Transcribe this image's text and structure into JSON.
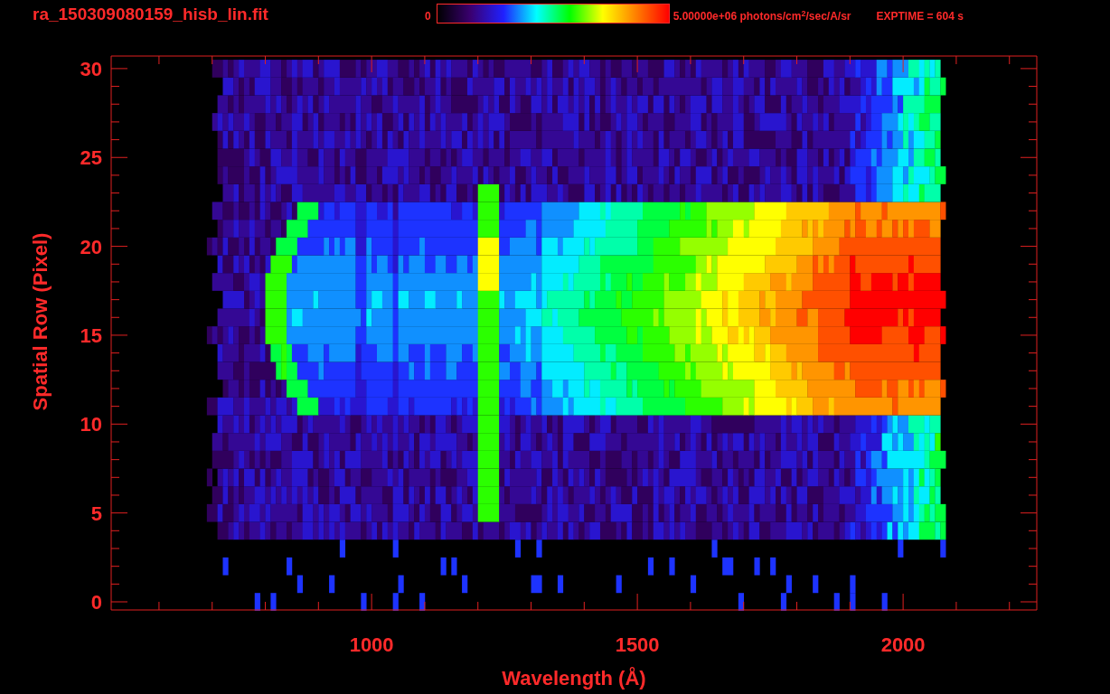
{
  "title": "ra_150309080159_hisb_lin.fit",
  "colorbar": {
    "min_label": "0",
    "max_label": "5.00000e+06 photons/cm$^{2}$/sec/A/sr"
  },
  "exposure": "EXPTIME = 604 s",
  "plot": {
    "xlabel": "Wavelength (Å)",
    "ylabel": "Spatial Row (Pixel)",
    "xticks": [
      "1000",
      "1500",
      "2000"
    ],
    "yticks": [
      "30",
      "25",
      "20",
      "15",
      "10",
      "5",
      "0"
    ]
  }
}
